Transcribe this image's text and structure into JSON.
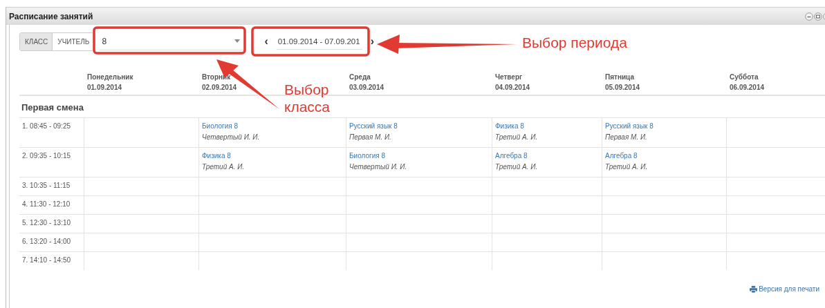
{
  "window": {
    "title": "Расписание занятий"
  },
  "mode_tabs": [
    {
      "label": "КЛАСС",
      "selected": true
    },
    {
      "label": "УЧИТЕЛЬ",
      "selected": false
    }
  ],
  "class_select": {
    "value": "8"
  },
  "period": {
    "prev": "‹",
    "value": "01.09.2014 - 07.09.201",
    "next": "›"
  },
  "days": [
    {
      "name": "Понедельник",
      "date": "01.09.2014"
    },
    {
      "name": "Вторник",
      "date": "02.09.2014"
    },
    {
      "name": "Среда",
      "date": "03.09.2014"
    },
    {
      "name": "Четверг",
      "date": "04.09.2014"
    },
    {
      "name": "Пятница",
      "date": "05.09.2014"
    },
    {
      "name": "Суббота",
      "date": "06.09.2014"
    }
  ],
  "shift_title": "Первая смена",
  "rows": [
    {
      "time": "1. 08:45 - 09:25",
      "lessons": [
        {
          "kind": "empty"
        },
        {
          "kind": "lesson",
          "subject": "Биология 8",
          "teacher": "Четвертый И. И."
        },
        {
          "kind": "lesson",
          "subject": "Русский язык 8",
          "teacher": "Первая М. И."
        },
        {
          "kind": "lesson",
          "subject": "Физика 8",
          "teacher": "Третий А. И."
        },
        {
          "kind": "lesson",
          "subject": "Русский язык 8",
          "teacher": "Первая М. И."
        },
        {
          "kind": "empty"
        }
      ]
    },
    {
      "time": "2. 09:35 - 10:15",
      "lessons": [
        {
          "kind": "empty"
        },
        {
          "kind": "lesson",
          "subject": "Физика 8",
          "teacher": "Третий А. И."
        },
        {
          "kind": "lesson",
          "subject": "Биология 8",
          "teacher": "Четвертый И. И."
        },
        {
          "kind": "lesson",
          "subject": "Алгебра 8",
          "teacher": "Третий А. И."
        },
        {
          "kind": "lesson",
          "subject": "Алгебра 8",
          "teacher": "Третий А. И."
        },
        {
          "kind": "empty"
        }
      ]
    },
    {
      "time": "3. 10:35 - 11:15",
      "lessons": [
        {
          "kind": "empty"
        },
        {
          "kind": "empty"
        },
        {
          "kind": "empty"
        },
        {
          "kind": "empty"
        },
        {
          "kind": "empty"
        },
        {
          "kind": "empty"
        }
      ]
    },
    {
      "time": "4. 11:30 - 12:10",
      "lessons": [
        {
          "kind": "empty"
        },
        {
          "kind": "empty"
        },
        {
          "kind": "empty"
        },
        {
          "kind": "empty"
        },
        {
          "kind": "empty"
        },
        {
          "kind": "empty"
        }
      ]
    },
    {
      "time": "5. 12:30 - 13:10",
      "lessons": [
        {
          "kind": "empty"
        },
        {
          "kind": "empty"
        },
        {
          "kind": "empty"
        },
        {
          "kind": "empty"
        },
        {
          "kind": "empty"
        },
        {
          "kind": "empty"
        }
      ]
    },
    {
      "time": "6. 13:20 - 14:00",
      "lessons": [
        {
          "kind": "empty"
        },
        {
          "kind": "empty"
        },
        {
          "kind": "empty"
        },
        {
          "kind": "empty"
        },
        {
          "kind": "empty"
        },
        {
          "kind": "empty"
        }
      ]
    },
    {
      "time": "7. 14:10 - 14:50",
      "lessons": [
        {
          "kind": "empty"
        },
        {
          "kind": "empty"
        },
        {
          "kind": "empty"
        },
        {
          "kind": "empty"
        },
        {
          "kind": "empty"
        },
        {
          "kind": "empty"
        }
      ]
    }
  ],
  "print_link": "Версия для печати",
  "annotations": [
    {
      "text": "Выбор периода"
    },
    {
      "text": "Выбор класса"
    }
  ]
}
